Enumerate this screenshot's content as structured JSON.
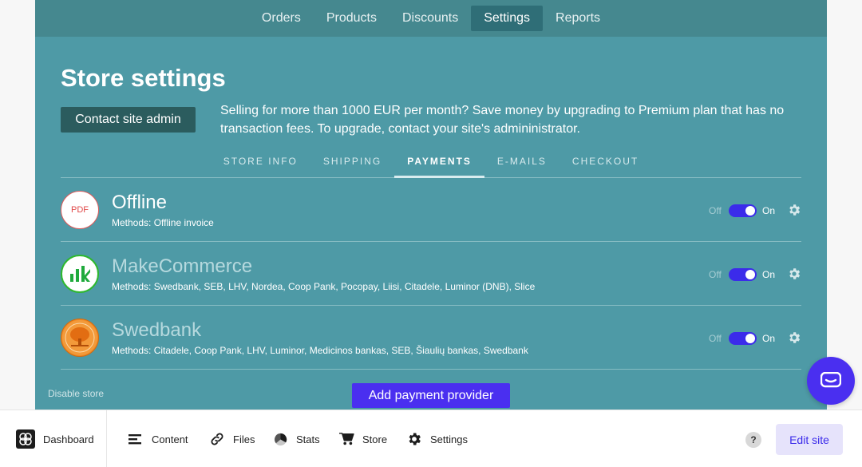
{
  "nav": {
    "items": [
      {
        "label": "Orders",
        "active": false
      },
      {
        "label": "Products",
        "active": false
      },
      {
        "label": "Discounts",
        "active": false
      },
      {
        "label": "Settings",
        "active": true
      },
      {
        "label": "Reports",
        "active": false
      }
    ]
  },
  "page": {
    "title": "Store settings",
    "contact_button": "Contact site admin",
    "promo_text": "Selling for more than 1000 EUR per month? Save money by upgrading to Premium plan that has no transaction fees. To upgrade, contact your site's admininistrator."
  },
  "tabs": [
    {
      "label": "STORE INFO",
      "active": false
    },
    {
      "label": "SHIPPING",
      "active": false
    },
    {
      "label": "PAYMENTS",
      "active": true
    },
    {
      "label": "E-MAILS",
      "active": false
    },
    {
      "label": "CHECKOUT",
      "active": false
    }
  ],
  "providers": [
    {
      "name": "Offline",
      "methods": "Methods: Offline invoice",
      "logo": "PDF",
      "off_label": "Off",
      "on_label": "On",
      "enabled": true
    },
    {
      "name": "MakeCommerce",
      "methods": "Methods: Swedbank, SEB, LHV, Nordea, Coop Pank, Pocopay, Liisi, Citadele, Luminor (DNB), Slice",
      "logo": "makecommerce-logo",
      "off_label": "Off",
      "on_label": "On",
      "enabled": true
    },
    {
      "name": "Swedbank",
      "methods": "Methods: Citadele, Coop Pank, LHV, Luminor, Medicinos bankas, SEB, Šiaulių bankas, Swedbank",
      "logo": "swedbank-logo",
      "off_label": "Off",
      "on_label": "On",
      "enabled": true
    }
  ],
  "footer": {
    "disable_store": "Disable store",
    "add_provider": "Add payment provider"
  },
  "bottombar": {
    "dashboard": "Dashboard",
    "content": "Content",
    "files": "Files",
    "stats": "Stats",
    "store": "Store",
    "settings": "Settings",
    "help": "?",
    "edit_site": "Edit site"
  },
  "colors": {
    "panel": "#4e9aa6",
    "accent": "#4a2ff0",
    "contact_button": "#2b5c5e"
  }
}
